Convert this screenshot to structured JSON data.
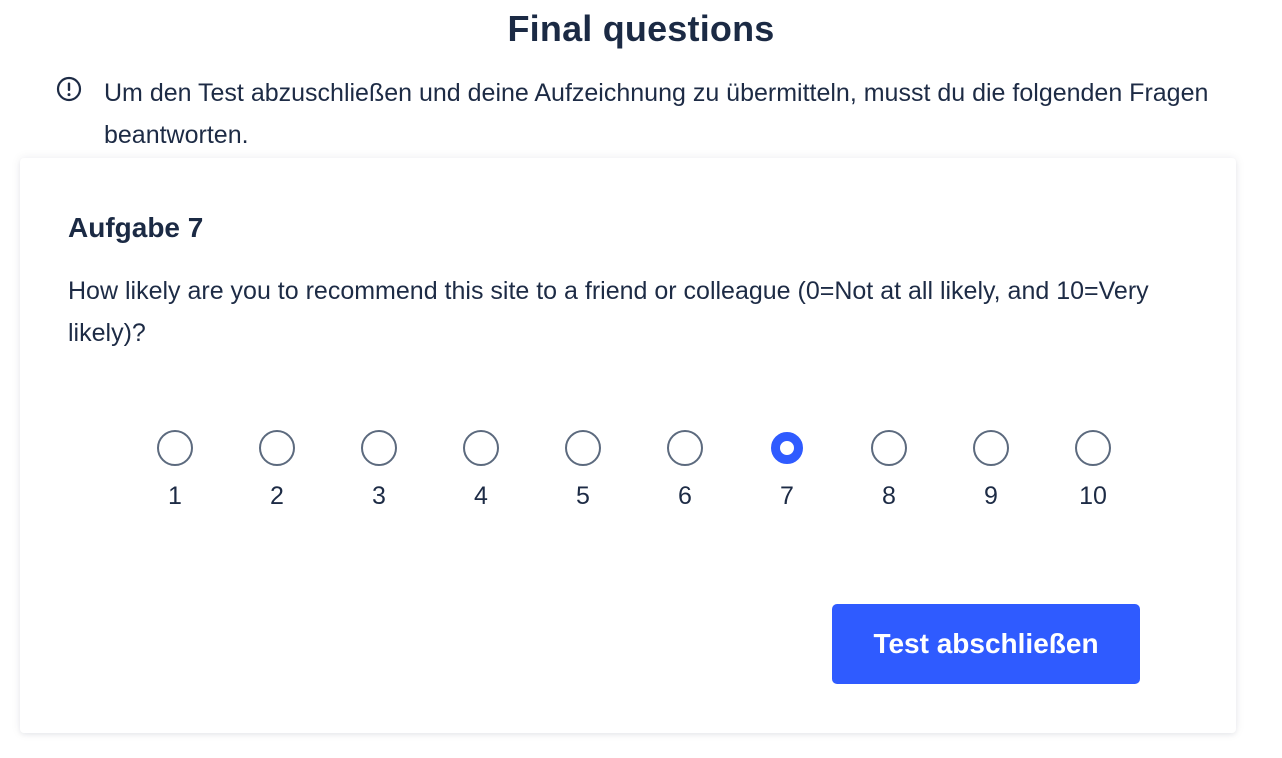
{
  "page": {
    "title": "Final questions"
  },
  "notice": {
    "icon": "exclamation-circle-icon",
    "text": "Um den Test abzuschließen und deine Aufzeichnung zu übermitteln, musst du die folgenden Fragen beantworten."
  },
  "task": {
    "title": "Aufgabe 7",
    "question": "How likely are you to recommend this site to a friend or colleague (0=Not at all likely, and 10=Very likely)?",
    "scale": {
      "options": [
        "1",
        "2",
        "3",
        "4",
        "5",
        "6",
        "7",
        "8",
        "9",
        "10"
      ],
      "selected": "7"
    },
    "submit_label": "Test abschließen"
  },
  "colors": {
    "accent": "#2f5bff",
    "text": "#1d2b45",
    "radio_border": "#5c6a7e"
  }
}
